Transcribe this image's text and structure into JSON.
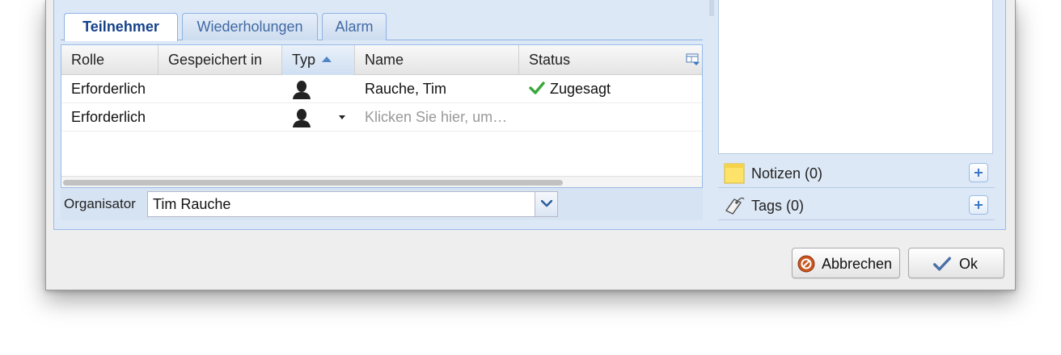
{
  "tabs": [
    {
      "label": "Teilnehmer",
      "active": true
    },
    {
      "label": "Wiederholungen",
      "active": false
    },
    {
      "label": "Alarm",
      "active": false
    }
  ],
  "grid": {
    "columns": [
      "Rolle",
      "Gespeichert in",
      "Typ",
      "Name",
      "Status"
    ],
    "sorted_column": "Typ",
    "sort_direction": "ascending",
    "rows": [
      {
        "rolle": "Erforderlich",
        "gespeichert_in": "",
        "typ": "person-icon",
        "name": "Rauche, Tim",
        "status": "Zugesagt",
        "status_icon": "check-icon"
      },
      {
        "rolle": "Erforderlich",
        "gespeichert_in": "",
        "typ": "person-icon",
        "name": "Klicken Sie hier, um…",
        "status": "",
        "status_icon": ""
      }
    ]
  },
  "organizer": {
    "label": "Organisator",
    "value": "Tim Rauche"
  },
  "side_panels": [
    {
      "label": "Notizen (0)",
      "icon": "note-icon"
    },
    {
      "label": "Tags (0)",
      "icon": "tag-icon"
    }
  ],
  "buttons": {
    "cancel": "Abbrechen",
    "ok": "Ok"
  },
  "colors": {
    "accent": "#15428b",
    "panel": "#dde8f6",
    "check": "#3aa83a",
    "cancel_icon": "#c8561e"
  }
}
